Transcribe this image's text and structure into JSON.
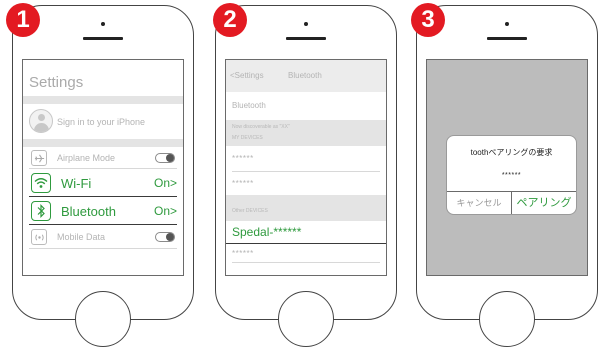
{
  "steps": [
    "1",
    "2",
    "3"
  ],
  "screen1": {
    "title": "Settings",
    "sign_in": "Sign in to your iPhone",
    "airplane": "Airplane Mode",
    "wifi": {
      "label": "Wi-Fi",
      "value": "On>"
    },
    "bluetooth": {
      "label": "Bluetooth",
      "value": "On>"
    },
    "mobile_data": "Mobile Data"
  },
  "screen2": {
    "back": "<Settings",
    "nav_title": "Bluetooth",
    "bluetooth_label": "Bluetooth",
    "discoverable": "Now discoverable as \"XX\"",
    "my_devices": "MY DEVICES",
    "my_device_1": "******",
    "my_device_2": "******",
    "other_devices": "Other DEVICES",
    "spedal": "Spedal-******",
    "other_device_2": "******"
  },
  "screen3": {
    "dialog_title": "toothペアリングの要求",
    "dialog_code": "******",
    "cancel": "キャンセル",
    "pair": "ペアリング"
  },
  "colors": {
    "badge": "#e31a22",
    "accent_green": "#2f9a3e"
  }
}
